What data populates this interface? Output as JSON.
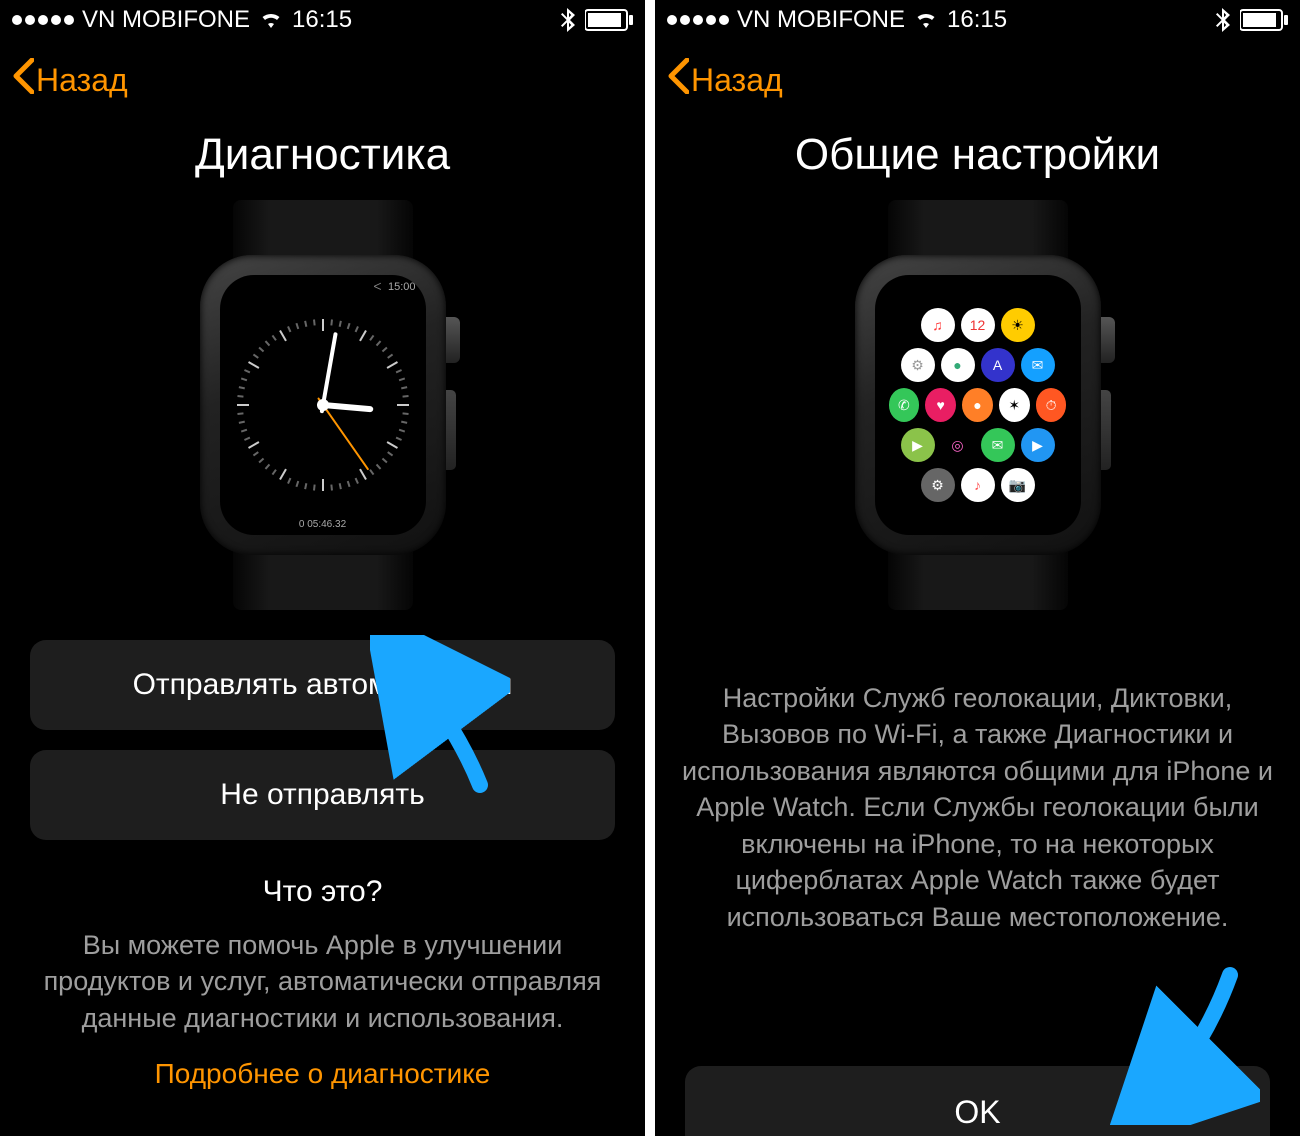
{
  "status": {
    "carrier": "VN MOBIFONE",
    "time": "16:15"
  },
  "nav": {
    "back_label": "Назад"
  },
  "left": {
    "title": "Диагностика",
    "watch_face": {
      "time_label": "15:00",
      "sub_label": "0 05:46.32"
    },
    "option_auto": "Отправлять автоматически",
    "option_no": "Не отправлять",
    "subhead": "Что это?",
    "body": "Вы можете помочь Apple в улучшении продуктов и услуг, автоматически отправляя данные диагностики и использования.",
    "link": "Подробнее о диагностике"
  },
  "right": {
    "title": "Общие настройки",
    "body": "Настройки Служб геолокации, Диктовки, Вызовов по Wi-Fi, а также Диагностики и использования являются общими для iPhone и Apple Watch. Если Службы геолокации были включены на iPhone, то на некоторых циферблатах Apple Watch также будет использоваться Ваше местоположение.",
    "ok": "OK",
    "apps": [
      {
        "bg": "#fff",
        "fg": "#f33",
        "t": "♫"
      },
      {
        "bg": "#fff",
        "fg": "#e33",
        "t": "12"
      },
      {
        "bg": "#ffcc00",
        "fg": "#000",
        "t": "☀"
      },
      {
        "bg": "#fff",
        "fg": "#999",
        "t": "⚙"
      },
      {
        "bg": "#fff",
        "fg": "#3a7",
        "t": "●"
      },
      {
        "bg": "#33c",
        "fg": "#fff",
        "t": "A"
      },
      {
        "bg": "#14a0ff",
        "fg": "#fff",
        "t": "✉"
      },
      {
        "bg": "#34c759",
        "fg": "#fff",
        "t": "✆"
      },
      {
        "bg": "#e91e63",
        "fg": "#fff",
        "t": "♥"
      },
      {
        "bg": "#ff7f27",
        "fg": "#fff",
        "t": "●"
      },
      {
        "bg": "#fff",
        "fg": "#000",
        "t": "✶"
      },
      {
        "bg": "#ff5722",
        "fg": "#fff",
        "t": "⏱"
      },
      {
        "bg": "#8bc34a",
        "fg": "#fff",
        "t": "▶"
      },
      {
        "bg": "#000",
        "fg": "#f6c",
        "t": "◎"
      },
      {
        "bg": "#34c759",
        "fg": "#fff",
        "t": "✉"
      },
      {
        "bg": "#2196f3",
        "fg": "#fff",
        "t": "▶"
      },
      {
        "bg": "#666",
        "fg": "#fff",
        "t": "⚙"
      },
      {
        "bg": "#fff",
        "fg": "#f55",
        "t": "♪"
      },
      {
        "bg": "#fff",
        "fg": "#555",
        "t": "📷"
      }
    ]
  },
  "colors": {
    "accent": "#ff9500",
    "arrow": "#1aa7ff"
  }
}
